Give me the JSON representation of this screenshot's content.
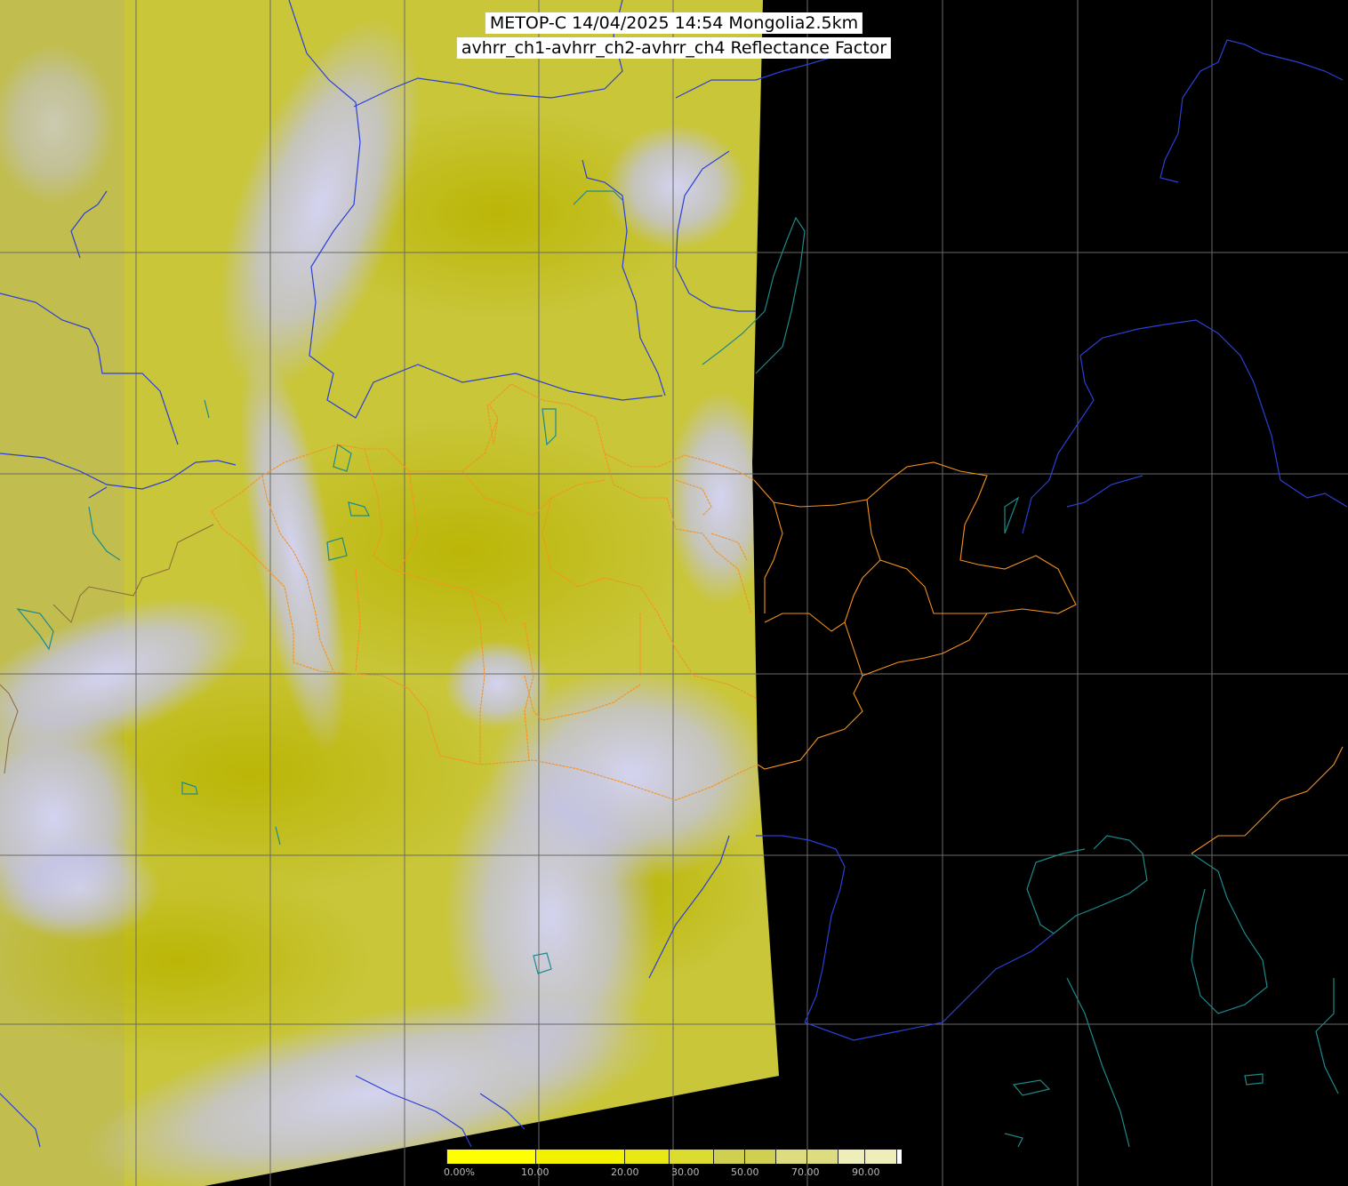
{
  "title": {
    "line1": "METOP-C 14/04/2025 14:54 Mongolia2.5km",
    "line2": "avhrr_ch1-avhrr_ch2-avhrr_ch4 Reflectance Factor"
  },
  "colors": {
    "background": "#000000",
    "imagery_base": "#c9c63a",
    "imagery_dense": "#bdb800",
    "cloud": "#c4c4f2",
    "grid": "#6a6a6a",
    "coastline_rivers": "#2b3fd6",
    "lakes_coast": "#1c8a8a",
    "mongolia_borders": "#f5921e",
    "other_borders": "#8a6a3a"
  },
  "colorbar": {
    "labels": [
      "0.00%",
      "10.00",
      "20.00",
      "30.00",
      "50.00",
      "70.00",
      "90.00"
    ],
    "colors": [
      "#ffff00",
      "#f2f200",
      "#e8e815",
      "#dcdc30",
      "#d0d050",
      "#dddd80",
      "#eeeebb",
      "#ffffff"
    ]
  }
}
